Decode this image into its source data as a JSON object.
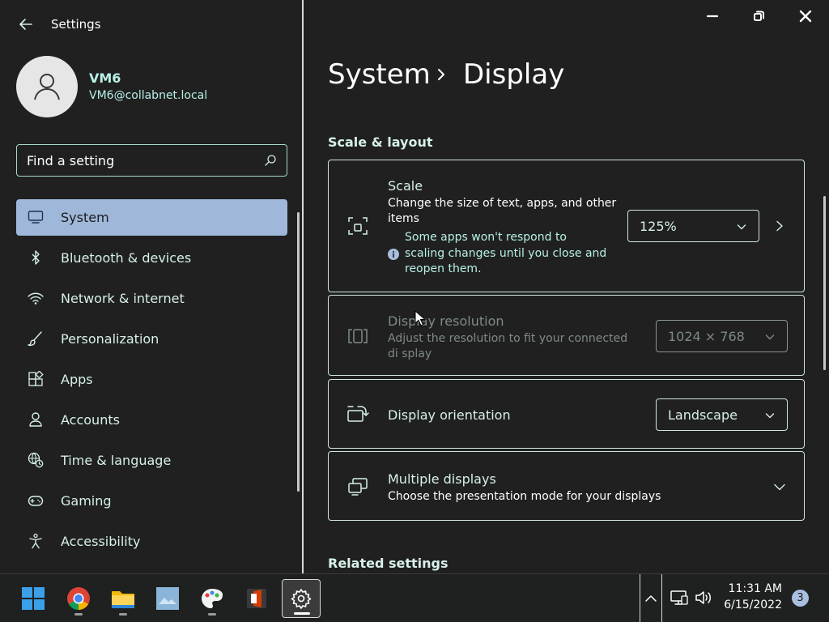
{
  "app": {
    "title": "Settings"
  },
  "user": {
    "name": "VM6",
    "email": "VM6@collabnet.local"
  },
  "search": {
    "placeholder": "Find a setting"
  },
  "nav": [
    {
      "label": "System",
      "icon": "monitor-icon",
      "selected": true
    },
    {
      "label": "Bluetooth & devices",
      "icon": "bluetooth-icon"
    },
    {
      "label": "Network & internet",
      "icon": "wifi-icon"
    },
    {
      "label": "Personalization",
      "icon": "brush-icon"
    },
    {
      "label": "Apps",
      "icon": "apps-icon"
    },
    {
      "label": "Accounts",
      "icon": "person-icon"
    },
    {
      "label": "Time & language",
      "icon": "globe-clock-icon"
    },
    {
      "label": "Gaming",
      "icon": "gamepad-icon"
    },
    {
      "label": "Accessibility",
      "icon": "accessibility-icon"
    }
  ],
  "breadcrumb": {
    "parent": "System",
    "current": "Display"
  },
  "section": {
    "title": "Scale & layout"
  },
  "scale": {
    "title": "Scale",
    "description": "Change the size of text, apps, and other items",
    "value": "125%",
    "info": "Some apps won't respond to scaling changes until you close and reopen them."
  },
  "resolution": {
    "title": "Display resolution",
    "description": "Adjust the resolution to fit your connected di splay",
    "value": "1024 × 768",
    "enabled": false
  },
  "orientation": {
    "title": "Display orientation",
    "value": "Landscape"
  },
  "multiple": {
    "title": "Multiple displays",
    "description": "Choose the presentation mode for your displays"
  },
  "related": {
    "title": "Related settings"
  },
  "taskbar": {
    "apps": [
      "start-icon",
      "chrome-icon",
      "file-explorer-icon",
      "photo-viewer-icon",
      "paint-icon",
      "office-icon",
      "settings-icon"
    ],
    "time": "11:31 AM",
    "date": "6/15/2022",
    "notifications": "3"
  },
  "colors": {
    "background": "#202020",
    "accent": "#9fb8d9",
    "text_accent": "#b7f0e6",
    "border": "#cfe7e1"
  }
}
